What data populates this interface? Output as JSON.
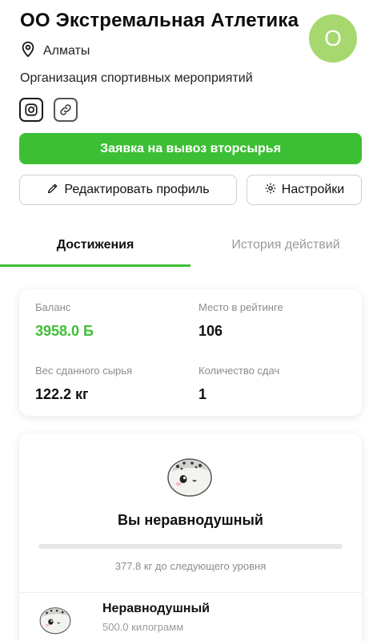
{
  "header": {
    "org_name": "ОО Экстремальная Атлетика",
    "avatar_letter": "О",
    "city": "Алматы",
    "org_type": "Организация спортивных мероприятий"
  },
  "icons": {
    "location": "map-pin-icon",
    "instagram": "instagram-icon",
    "link": "link-icon",
    "edit": "pencil-icon",
    "settings": "gear-icon"
  },
  "actions": {
    "primary_label": "Заявка на вывоз вторсырья",
    "edit_label": "Редактировать профиль",
    "settings_label": "Настройки"
  },
  "tabs": [
    {
      "label": "Достижения",
      "active": true
    },
    {
      "label": "История действий",
      "active": false
    }
  ],
  "stats": {
    "balance_label": "Баланс",
    "balance_value": "3958.0 Б",
    "rank_label": "Место в рейтинге",
    "rank_value": "106",
    "weight_label": "Вес сданного сырья",
    "weight_value": "122.2 кг",
    "count_label": "Количество сдач",
    "count_value": "1"
  },
  "level": {
    "title": "Вы неравнодушный",
    "progress_fraction": 0.0,
    "next_level_text": "377.8 кг до следующего уровня",
    "item_name": "Неравнодушный",
    "item_sub": "500.0 килограмм"
  },
  "colors": {
    "accent": "#3dbf35",
    "avatar": "#a6d86f",
    "muted": "#8c8c8c"
  }
}
